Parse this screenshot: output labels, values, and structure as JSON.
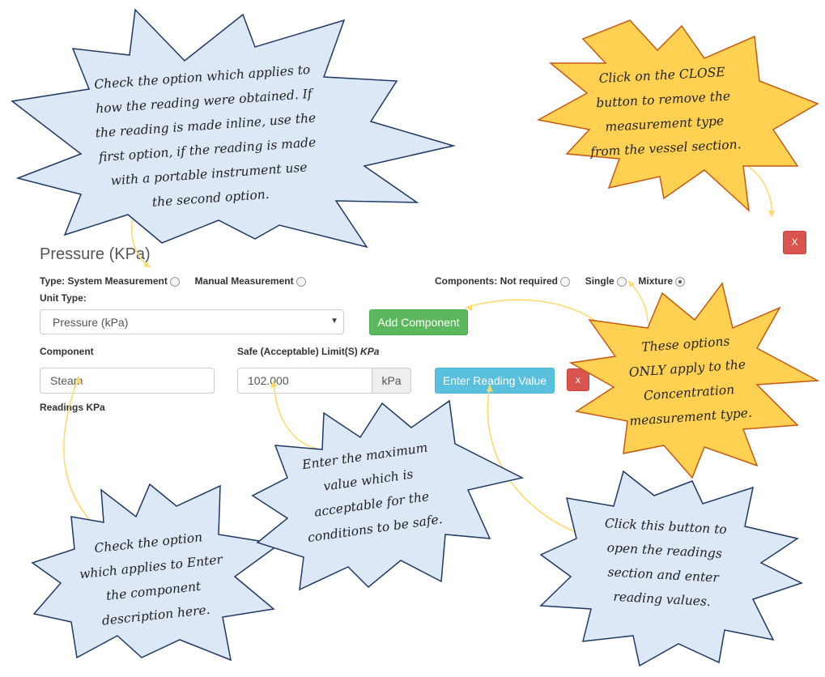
{
  "form": {
    "title": "Pressure (KPa)",
    "type_label": "Type:",
    "type_option1": "System Measurement",
    "type_option2": "Manual Measurement",
    "components_label": "Components:",
    "comp_option1": "Not required",
    "comp_option2": "Single",
    "comp_option3": "Mixture",
    "comp_selected": "Mixture",
    "unit_type_label": "Unit Type:",
    "unit_type_value": "Pressure (kPa)",
    "add_component": "Add Component",
    "component_label": "Component",
    "component_value": "Steam",
    "safe_limit_label": "Safe (Acceptable) Limit(S)",
    "safe_limit_unit_label": "KPa",
    "safe_limit_value": "102.000",
    "safe_limit_addon": "kPa",
    "enter_reading": "Enter Reading Value",
    "remove_component": "x",
    "close_section": "X",
    "readings_label": "Readings KPa"
  },
  "callouts": {
    "type_option_help": [
      "Check the option which applies to",
      "how the reading were obtained. If",
      "the reading is made inline, use the",
      "first option, if the reading is made",
      "with a portable instrument use",
      "the second option."
    ],
    "close_help": [
      "Click on the CLOSE",
      "button to remove the",
      "measurement type",
      "from the vessel section."
    ],
    "components_help": [
      "These options",
      "ONLY apply to the",
      "Concentration",
      "measurement type."
    ],
    "component_help": [
      "Check the option",
      "which applies to Enter",
      "the component",
      "description here."
    ],
    "limit_help": [
      "Enter the maximum",
      "value which is",
      "acceptable for the",
      "conditions to be safe."
    ],
    "reading_help": [
      "Click this button to",
      "open the readings",
      "section and enter",
      "reading values."
    ]
  },
  "colors": {
    "blue_callout_fill": "#dce8f6",
    "blue_callout_stroke": "#1f3864",
    "yellow_callout_fill": "#ffd152",
    "yellow_callout_stroke": "#c45a11",
    "arrow": "#ffd966",
    "add_button": "#5cb85c",
    "reading_button": "#5bc0de",
    "close_button": "#d9534f"
  }
}
